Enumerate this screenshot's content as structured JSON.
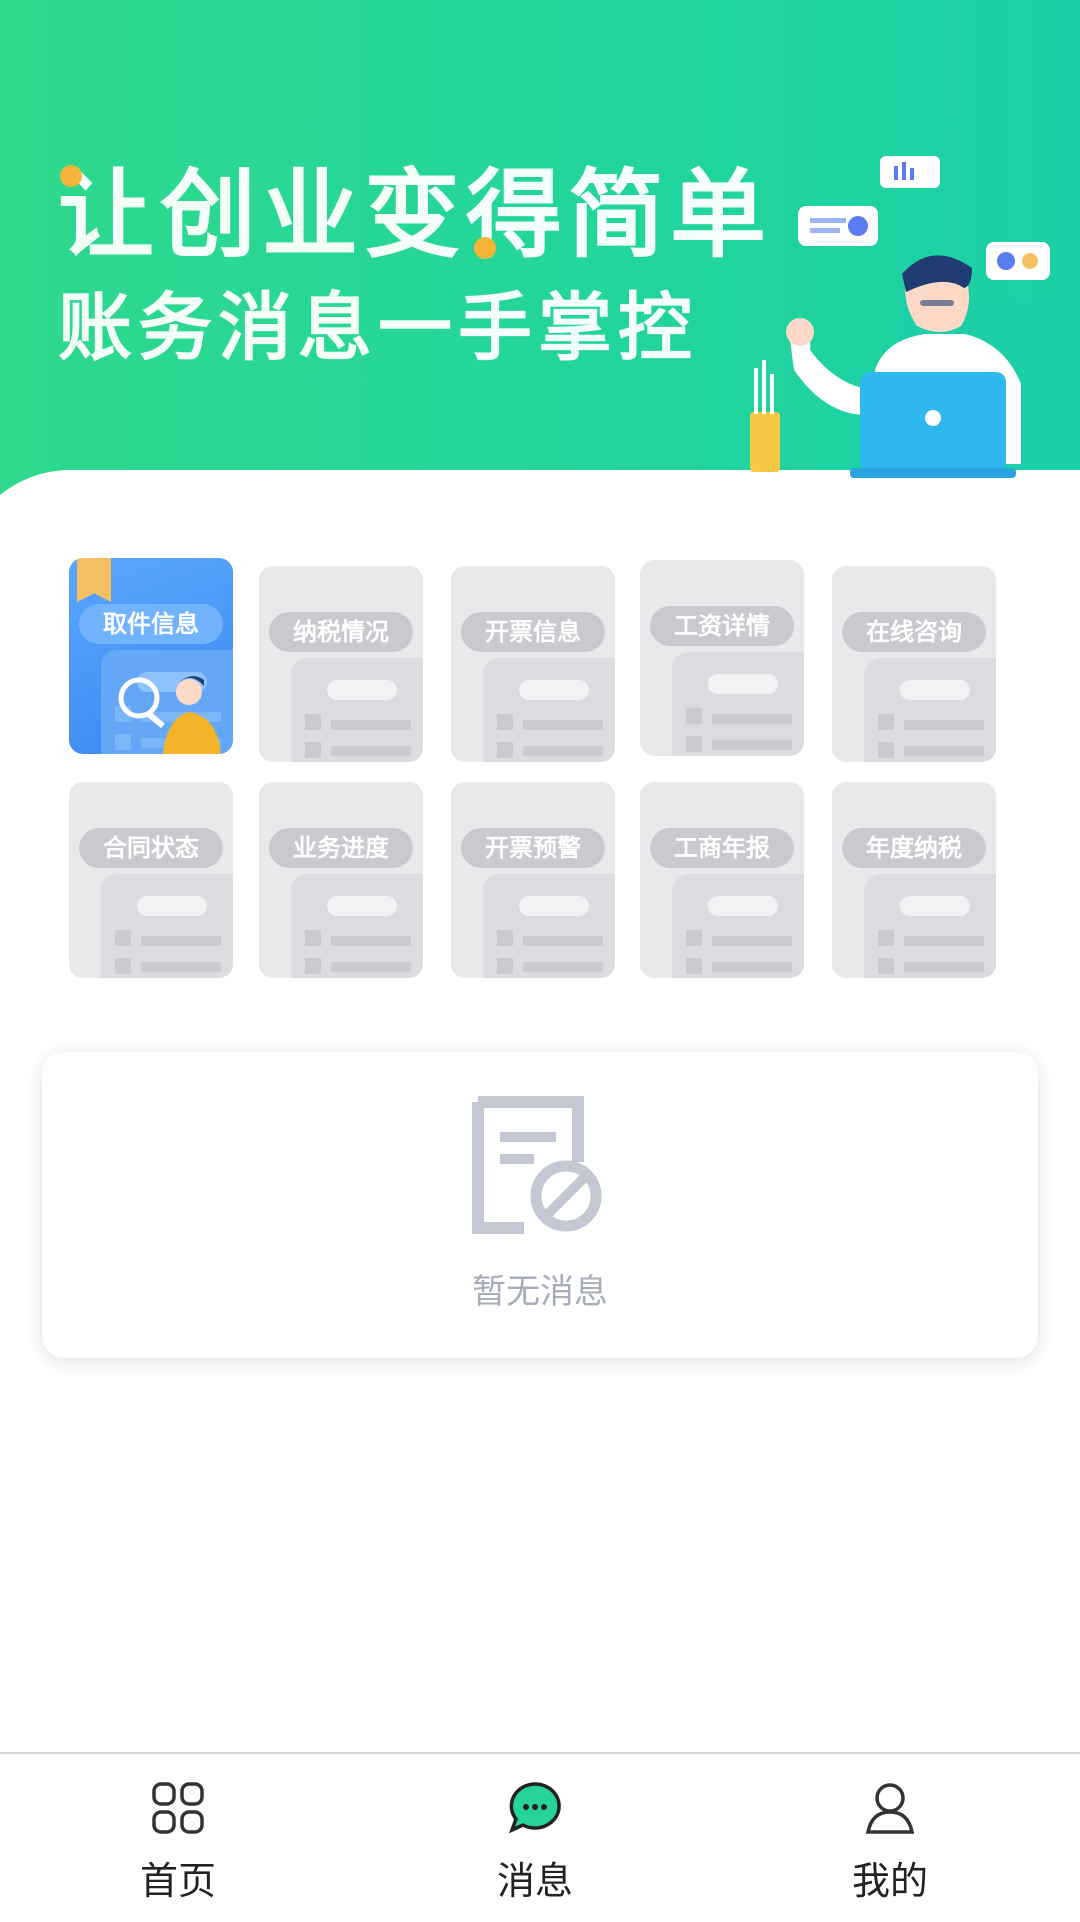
{
  "banner": {
    "line1": "让创业变得简单",
    "line2": "账务消息一手掌控"
  },
  "menu": [
    {
      "label": "取件信息",
      "active": true
    },
    {
      "label": "纳税情况",
      "active": false
    },
    {
      "label": "开票信息",
      "active": false
    },
    {
      "label": "工资详情",
      "active": false
    },
    {
      "label": "在线咨询",
      "active": false
    },
    {
      "label": "合同状态",
      "active": false
    },
    {
      "label": "业务进度",
      "active": false
    },
    {
      "label": "开票预警",
      "active": false
    },
    {
      "label": "工商年报",
      "active": false
    },
    {
      "label": "年度纳税",
      "active": false
    }
  ],
  "messages": {
    "empty_text": "暂无消息"
  },
  "tabbar": {
    "home": "首页",
    "messages": "消息",
    "mine": "我的",
    "active": "messages"
  },
  "colors": {
    "banner_start": "#2ed98c",
    "banner_end": "#1ccfa6",
    "active_tile": "#3a86f0",
    "tab_accent": "#27d39a"
  }
}
